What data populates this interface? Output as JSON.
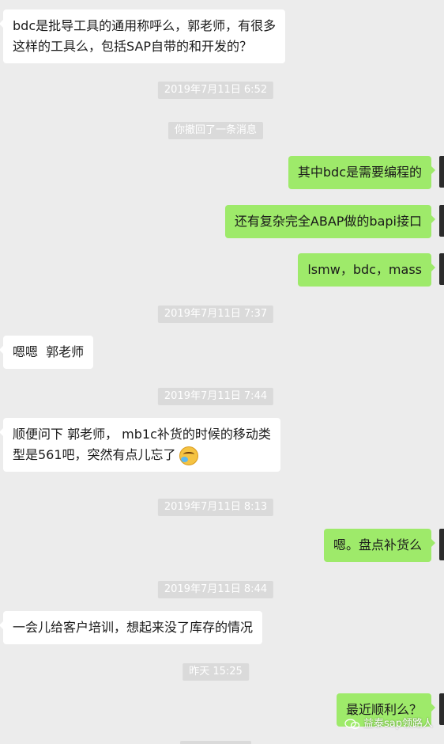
{
  "chat": {
    "messages": [
      {
        "side": "left",
        "text": "bdc是批导工具的通用称呼么，郭老师，有很多",
        "text2": "这样的工具么，包括SAP自带的和开发的？"
      },
      {
        "type": "timestamp",
        "text": "2019年7月11日 6:52"
      },
      {
        "type": "system",
        "text": "你撤回了一条消息"
      },
      {
        "side": "right",
        "text": "其中bdc是需要编程的"
      },
      {
        "side": "right",
        "text": "还有复杂完全ABAP做的bapi接口"
      },
      {
        "side": "right",
        "text": "lsmw，bdc，mass"
      },
      {
        "type": "timestamp",
        "text": "2019年7月11日 7:37"
      },
      {
        "side": "left",
        "text": "嗯嗯  郭老师"
      },
      {
        "type": "timestamp",
        "text": "2019年7月11日 7:44"
      },
      {
        "side": "left",
        "text": "顺便问下 郭老师， mb1c补货的时候的移动类",
        "text2": "型是561吧，突然有点儿忘了",
        "emoji": "face-with-tears-emoji"
      },
      {
        "type": "timestamp",
        "text": "2019年7月11日 8:13"
      },
      {
        "side": "right",
        "text": "嗯。盘点补货么"
      },
      {
        "type": "timestamp",
        "text": "2019年7月11日 8:44"
      },
      {
        "side": "left",
        "text": "一会儿给客户培训，想起来没了库存的情况"
      },
      {
        "type": "timestamp",
        "text": "昨天 15:25"
      },
      {
        "side": "right",
        "text": "最近顺利么？"
      }
    ]
  },
  "watermark": {
    "text": "益泰sap领路人",
    "icon": "wechat-icon"
  },
  "colors": {
    "background": "#ececec",
    "incoming_bubble": "#ffffff",
    "outgoing_bubble": "#9eea6a",
    "timestamp_bg": "#dadada"
  }
}
